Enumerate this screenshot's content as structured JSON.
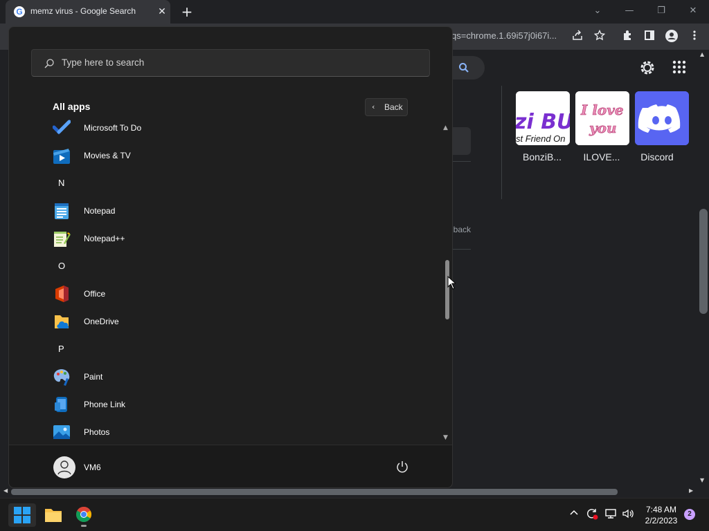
{
  "browser": {
    "tab_title": "memz virus - Google Search",
    "favicon_letter": "G",
    "tab_close_glyph": "✕",
    "new_tab_glyph": "+",
    "url_fragment": "qs=chrome.1.69i57j0i67i...",
    "window_controls": {
      "tab_search": "⌄",
      "minimize": "—",
      "restore": "❐",
      "close": "✕"
    }
  },
  "page": {
    "tiles": [
      {
        "label": "BonziB...",
        "image_text_top": "zi BU",
        "image_text_bottom": "st Friend On"
      },
      {
        "label": "ILOVE...",
        "image_text_top": "I love",
        "image_text_bottom": "you"
      },
      {
        "label": "Discord"
      }
    ],
    "feedback_text": "lback"
  },
  "start_menu": {
    "search_placeholder": "Type here to search",
    "section_title": "All apps",
    "back_label": "Back",
    "apps": [
      {
        "type": "app",
        "name": "Microsoft To Do",
        "icon": "todo-icon"
      },
      {
        "type": "app",
        "name": "Movies & TV",
        "icon": "movies-tv-icon"
      },
      {
        "type": "letter",
        "name": "N"
      },
      {
        "type": "app",
        "name": "Notepad",
        "icon": "notepad-icon"
      },
      {
        "type": "app",
        "name": "Notepad++",
        "icon": "notepad-plus-plus-icon"
      },
      {
        "type": "letter",
        "name": "O"
      },
      {
        "type": "app",
        "name": "Office",
        "icon": "office-icon"
      },
      {
        "type": "app",
        "name": "OneDrive",
        "icon": "onedrive-icon"
      },
      {
        "type": "letter",
        "name": "P"
      },
      {
        "type": "app",
        "name": "Paint",
        "icon": "paint-icon"
      },
      {
        "type": "app",
        "name": "Phone Link",
        "icon": "phone-link-icon"
      },
      {
        "type": "app",
        "name": "Photos",
        "icon": "photos-icon"
      }
    ],
    "user_name": "VM6"
  },
  "taskbar": {
    "time": "7:48 AM",
    "date": "2/2/2023",
    "notification_count": "2"
  },
  "colors": {
    "chrome_bg": "#202124",
    "start_bg": "#1f1f1f",
    "taskbar_bg": "#1c1c1c",
    "windows_blue": "#0078d4",
    "discord": "#5865f2"
  }
}
